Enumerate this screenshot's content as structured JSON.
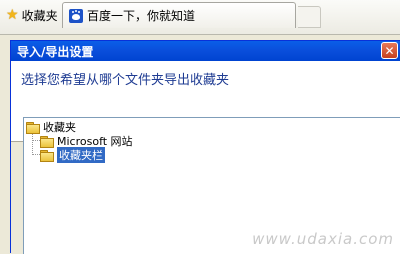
{
  "browser": {
    "favorites_label": "收藏夹",
    "tab_title": "百度一下，你就知道"
  },
  "dialog": {
    "title": "导入/导出设置",
    "close_glyph": "✕",
    "heading": "选择您希望从哪个文件夹导出收藏夹",
    "tree": {
      "root": "收藏夹",
      "children": [
        "Microsoft 网站",
        "收藏夹栏"
      ],
      "selected": "收藏夹栏"
    }
  },
  "icons": {
    "favorites": "star-icon",
    "tab": "baidu-paw-icon",
    "folder": "folder-icon",
    "close": "close-icon"
  },
  "colors": {
    "titlebar": "#0a4fdc",
    "selection": "#316ac5",
    "heading_text": "#1f3c93"
  },
  "watermark": "www.udaxia.com"
}
